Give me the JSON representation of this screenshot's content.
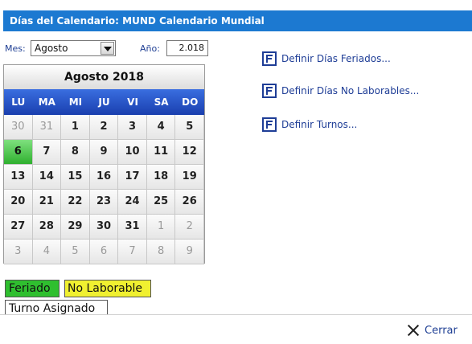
{
  "title": "Días del Calendario: MUND Calendario Mundial",
  "mes": {
    "label": "Mes:",
    "value": "Agosto"
  },
  "ano": {
    "label": "Año:",
    "value": "2.018"
  },
  "calendar": {
    "title": "Agosto  2018",
    "days": [
      "LU",
      "MA",
      "MI",
      "JU",
      "VI",
      "SA",
      "DO"
    ],
    "weeks": [
      [
        "30",
        "31",
        "1",
        "2",
        "3",
        "4",
        "5"
      ],
      [
        "6",
        "7",
        "8",
        "9",
        "10",
        "11",
        "12"
      ],
      [
        "13",
        "14",
        "15",
        "16",
        "17",
        "18",
        "19"
      ],
      [
        "20",
        "21",
        "22",
        "23",
        "24",
        "25",
        "26"
      ],
      [
        "27",
        "28",
        "29",
        "30",
        "31",
        "1",
        "2"
      ],
      [
        "3",
        "4",
        "5",
        "6",
        "7",
        "8",
        "9"
      ]
    ]
  },
  "links": [
    {
      "label": "Definir Días Feriados...",
      "icon": "definir-icon"
    },
    {
      "label": "Definir Días No Laborables...",
      "icon": "definir-icon"
    },
    {
      "label": "Definir Turnos...",
      "icon": "definir-icon"
    }
  ],
  "legend": {
    "feriado": "Feriado",
    "no_laborable": "No Laborable",
    "turno": "Turno Asignado"
  },
  "colors": {
    "title_bar": "#1c79d1",
    "holiday": "#2fbf2f",
    "no_laborable": "#f0f030",
    "link": "#1e3d96"
  },
  "footer": {
    "close_label": "Cerrar"
  }
}
